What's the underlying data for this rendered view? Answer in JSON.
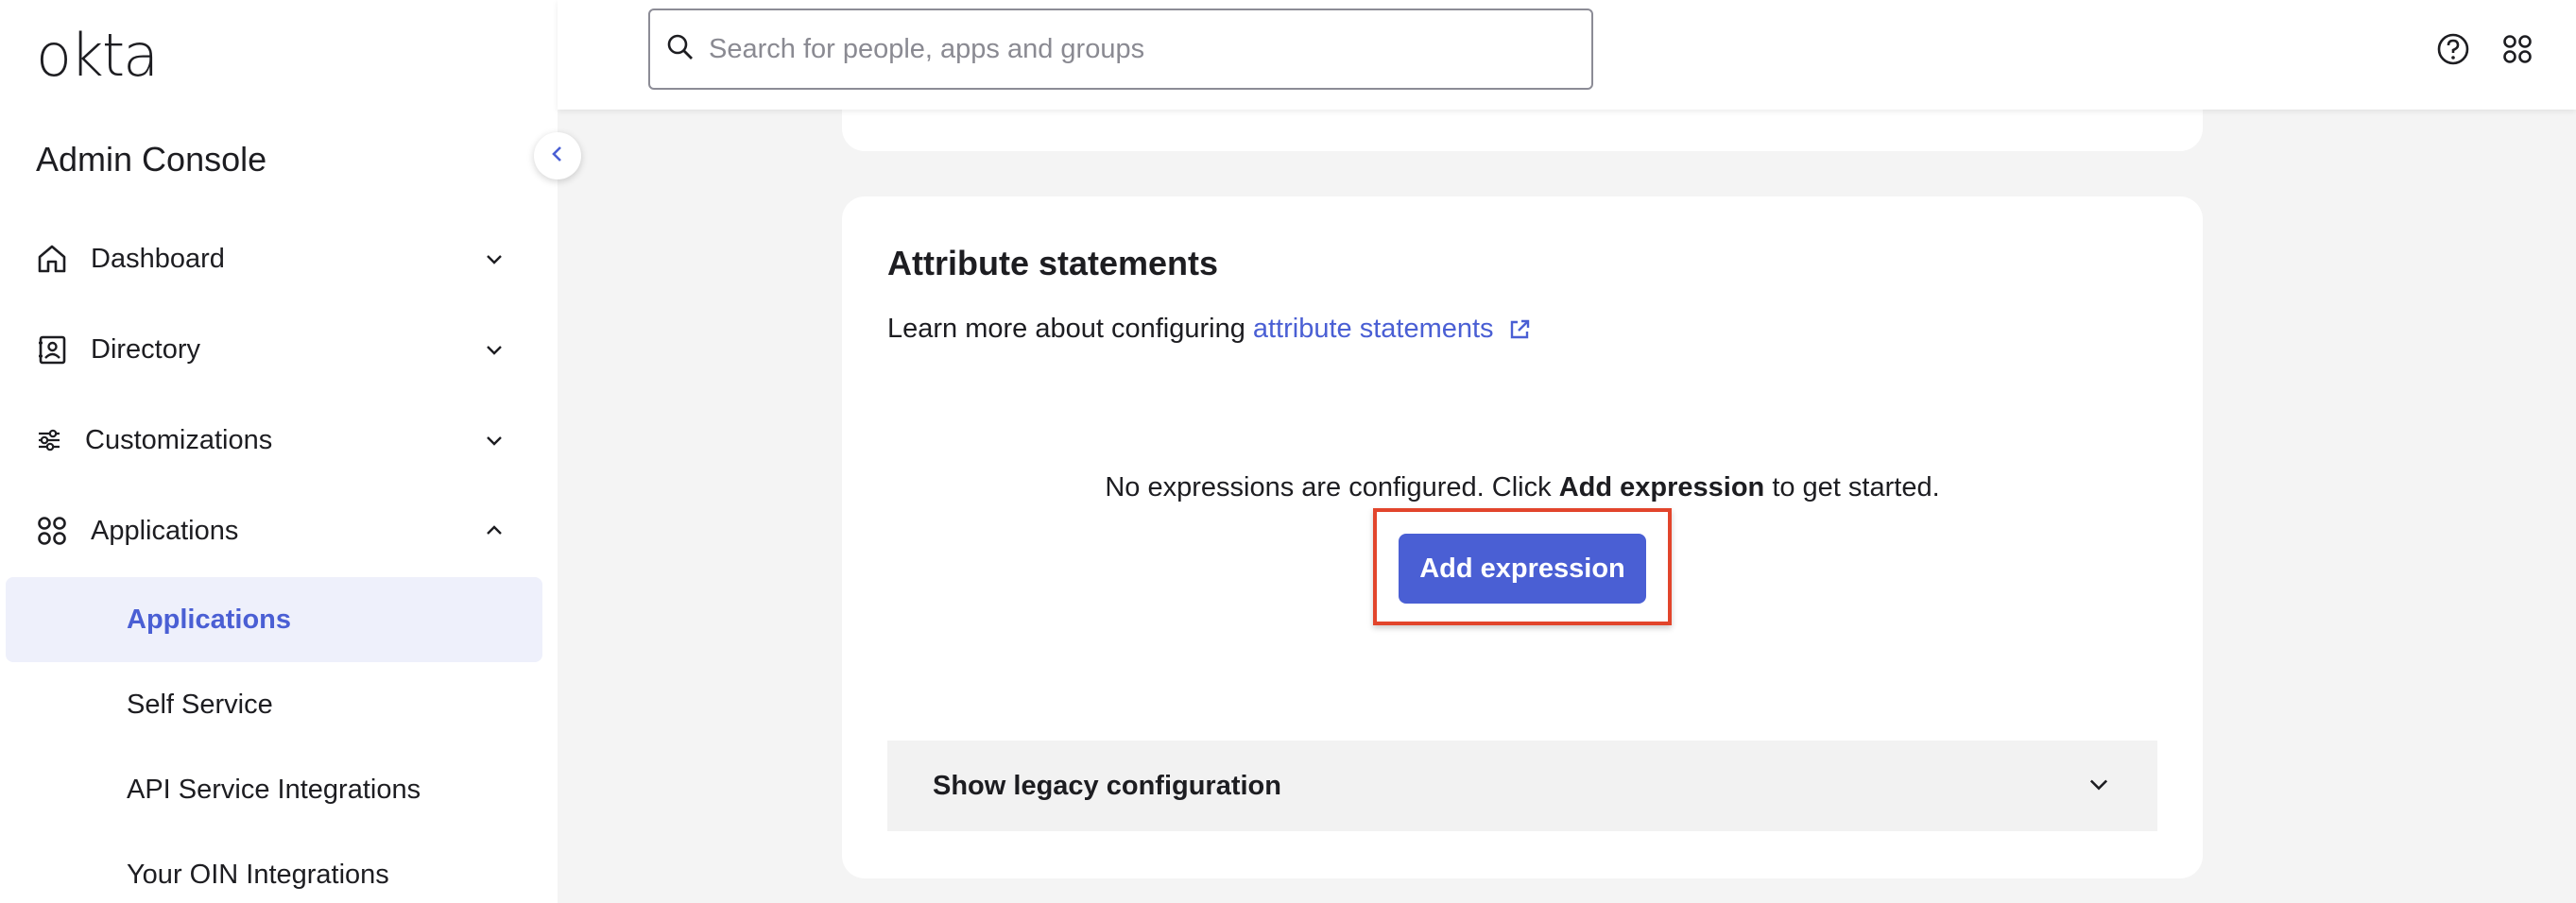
{
  "brand": {
    "logo_text": "okta",
    "accent": "#4a5fd4",
    "highlight": "#e2452c"
  },
  "sidebar": {
    "title": "Admin Console",
    "collapse_icon": "chevron-left-icon",
    "items": [
      {
        "label": "Dashboard",
        "icon": "home-icon",
        "expanded": false
      },
      {
        "label": "Directory",
        "icon": "directory-icon",
        "expanded": false
      },
      {
        "label": "Customizations",
        "icon": "sliders-icon",
        "expanded": false
      },
      {
        "label": "Applications",
        "icon": "apps-grid-icon",
        "expanded": true
      }
    ],
    "subitems": [
      {
        "label": "Applications",
        "active": true
      },
      {
        "label": "Self Service",
        "active": false
      },
      {
        "label": "API Service Integrations",
        "active": false
      },
      {
        "label": "Your OIN Integrations",
        "active": false
      }
    ]
  },
  "topbar": {
    "search_placeholder": "Search for people, apps and groups",
    "help_icon": "help-icon",
    "apps_icon": "app-switcher-icon"
  },
  "card": {
    "title": "Attribute statements",
    "learn_prefix": "Learn more about configuring",
    "learn_link": "attribute statements",
    "empty_prefix": "No expressions are configured. Click",
    "empty_bold": "Add expression",
    "empty_suffix": "to get started.",
    "add_button": "Add expression",
    "legacy_label": "Show legacy configuration"
  }
}
